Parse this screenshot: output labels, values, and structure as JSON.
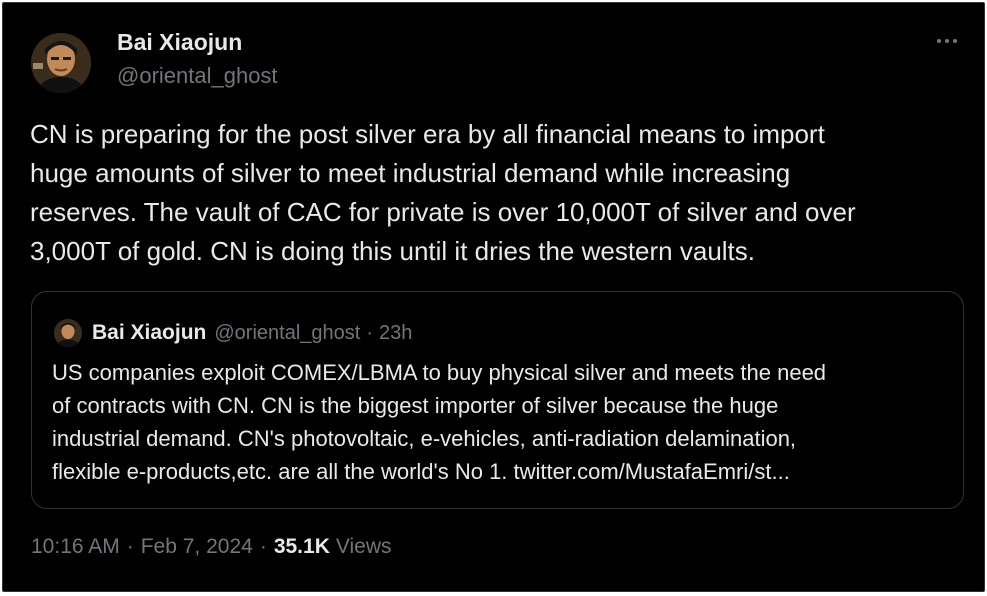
{
  "author": {
    "display_name": "Bai Xiaojun",
    "handle": "@oriental_ghost",
    "avatar_icon": "avatar-photo"
  },
  "tweet": {
    "text_lines": [
      "CN is preparing for the post silver era by all financial means to import",
      "huge amounts of silver to meet industrial demand while increasing",
      "reserves. The vault of CAC for private is over 10,000T of silver and over",
      "3,000T of gold. CN is doing this until it dries the western vaults."
    ]
  },
  "quoted_tweet": {
    "display_name": "Bai Xiaojun",
    "handle": "@oriental_ghost",
    "separator": "·",
    "time_ago": "23h",
    "text_lines": [
      "US companies exploit COMEX/LBMA to buy physical silver and meets the need",
      "of contracts with CN. CN is the biggest importer of silver because the huge",
      "industrial demand. CN's photovoltaic, e-vehicles, anti-radiation delamination,",
      "flexible e-products,etc. are all the world's No 1. twitter.com/MustafaEmri/st..."
    ]
  },
  "meta": {
    "time": "10:16 AM",
    "separator": "·",
    "date": "Feb 7, 2024",
    "views_count": "35.1K",
    "views_label": "Views"
  },
  "colors": {
    "background": "#000000",
    "primary_text": "#e7e9ea",
    "secondary_text": "#71767b",
    "border": "#2f3336"
  },
  "icons": {
    "more": "more-horizontal-icon"
  }
}
